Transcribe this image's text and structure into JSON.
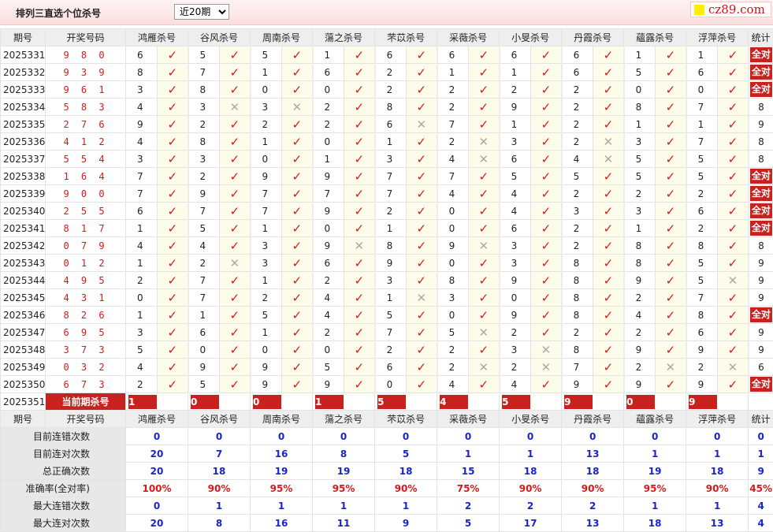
{
  "header": {
    "title": "排列三直选个位杀号",
    "period_selected": "近20期",
    "site": "cz89.com"
  },
  "columns": {
    "issue": "期号",
    "code": "开奖号码",
    "experts": [
      "鸿雁杀号",
      "谷风杀号",
      "周南杀号",
      "蕩之杀号",
      "芣苡杀号",
      "采薇杀号",
      "小旻杀号",
      "丹霞杀号",
      "蘊露杀号",
      "浮萍杀号"
    ],
    "stat": "统计"
  },
  "rows": [
    {
      "issue": "2025331",
      "code": "9 8 0",
      "kills": [
        6,
        5,
        5,
        1,
        6,
        6,
        6,
        6,
        1,
        1
      ],
      "marks": [
        1,
        1,
        1,
        1,
        1,
        1,
        1,
        1,
        1,
        1
      ],
      "stat": "全对"
    },
    {
      "issue": "2025332",
      "code": "9 3 9",
      "kills": [
        8,
        7,
        1,
        6,
        2,
        1,
        1,
        6,
        5,
        6
      ],
      "marks": [
        1,
        1,
        1,
        1,
        1,
        1,
        1,
        1,
        1,
        1
      ],
      "stat": "全对"
    },
    {
      "issue": "2025333",
      "code": "9 6 1",
      "kills": [
        3,
        8,
        0,
        0,
        2,
        2,
        2,
        2,
        0,
        0
      ],
      "marks": [
        1,
        1,
        1,
        1,
        1,
        1,
        1,
        1,
        1,
        1
      ],
      "stat": "全对"
    },
    {
      "issue": "2025334",
      "code": "5 8 3",
      "kills": [
        4,
        3,
        3,
        2,
        8,
        2,
        9,
        2,
        8,
        7
      ],
      "marks": [
        1,
        0,
        0,
        1,
        1,
        1,
        1,
        1,
        1,
        1
      ],
      "stat": "8"
    },
    {
      "issue": "2025335",
      "code": "2 7 6",
      "kills": [
        9,
        2,
        2,
        2,
        6,
        7,
        1,
        2,
        1,
        1
      ],
      "marks": [
        1,
        1,
        1,
        1,
        0,
        1,
        1,
        1,
        1,
        1
      ],
      "stat": "9"
    },
    {
      "issue": "2025336",
      "code": "4 1 2",
      "kills": [
        4,
        8,
        1,
        0,
        1,
        2,
        3,
        2,
        3,
        7
      ],
      "marks": [
        1,
        1,
        1,
        1,
        1,
        0,
        1,
        0,
        1,
        1
      ],
      "stat": "8"
    },
    {
      "issue": "2025337",
      "code": "5 5 4",
      "kills": [
        3,
        3,
        0,
        1,
        3,
        4,
        6,
        4,
        5,
        5
      ],
      "marks": [
        1,
        1,
        1,
        1,
        1,
        0,
        1,
        0,
        1,
        1
      ],
      "stat": "8"
    },
    {
      "issue": "2025338",
      "code": "1 6 4",
      "kills": [
        7,
        2,
        9,
        9,
        7,
        7,
        5,
        5,
        5,
        5
      ],
      "marks": [
        1,
        1,
        1,
        1,
        1,
        1,
        1,
        1,
        1,
        1
      ],
      "stat": "全对"
    },
    {
      "issue": "2025339",
      "code": "9 0 0",
      "kills": [
        7,
        9,
        7,
        7,
        7,
        4,
        4,
        2,
        2,
        2
      ],
      "marks": [
        1,
        1,
        1,
        1,
        1,
        1,
        1,
        1,
        1,
        1
      ],
      "stat": "全对"
    },
    {
      "issue": "2025340",
      "code": "2 5 5",
      "kills": [
        6,
        7,
        7,
        9,
        2,
        0,
        4,
        3,
        3,
        6
      ],
      "marks": [
        1,
        1,
        1,
        1,
        1,
        1,
        1,
        1,
        1,
        1
      ],
      "stat": "全对"
    },
    {
      "issue": "2025341",
      "code": "8 1 7",
      "kills": [
        1,
        5,
        1,
        0,
        1,
        0,
        6,
        2,
        1,
        2
      ],
      "marks": [
        1,
        1,
        1,
        1,
        1,
        1,
        1,
        1,
        1,
        1
      ],
      "stat": "全对"
    },
    {
      "issue": "2025342",
      "code": "0 7 9",
      "kills": [
        4,
        4,
        3,
        9,
        8,
        9,
        3,
        2,
        8,
        8
      ],
      "marks": [
        1,
        1,
        1,
        0,
        1,
        0,
        1,
        1,
        1,
        1
      ],
      "stat": "8"
    },
    {
      "issue": "2025343",
      "code": "0 1 2",
      "kills": [
        1,
        2,
        3,
        6,
        9,
        0,
        3,
        8,
        8,
        5
      ],
      "marks": [
        1,
        0,
        1,
        1,
        1,
        1,
        1,
        1,
        1,
        1
      ],
      "stat": "9"
    },
    {
      "issue": "2025344",
      "code": "4 9 5",
      "kills": [
        2,
        7,
        1,
        2,
        3,
        8,
        9,
        8,
        9,
        5
      ],
      "marks": [
        1,
        1,
        1,
        1,
        1,
        1,
        1,
        1,
        1,
        0
      ],
      "stat": "9"
    },
    {
      "issue": "2025345",
      "code": "4 3 1",
      "kills": [
        0,
        7,
        2,
        4,
        1,
        3,
        0,
        8,
        2,
        7
      ],
      "marks": [
        1,
        1,
        1,
        1,
        0,
        1,
        1,
        1,
        1,
        1
      ],
      "stat": "9"
    },
    {
      "issue": "2025346",
      "code": "8 2 6",
      "kills": [
        1,
        1,
        5,
        4,
        5,
        0,
        9,
        8,
        4,
        8
      ],
      "marks": [
        1,
        1,
        1,
        1,
        1,
        1,
        1,
        1,
        1,
        1
      ],
      "stat": "全对"
    },
    {
      "issue": "2025347",
      "code": "6 9 5",
      "kills": [
        3,
        6,
        1,
        2,
        7,
        5,
        2,
        2,
        2,
        6
      ],
      "marks": [
        1,
        1,
        1,
        1,
        1,
        0,
        1,
        1,
        1,
        1
      ],
      "stat": "9"
    },
    {
      "issue": "2025348",
      "code": "3 7 3",
      "kills": [
        5,
        0,
        0,
        0,
        2,
        2,
        3,
        8,
        9,
        9
      ],
      "marks": [
        1,
        1,
        1,
        1,
        1,
        1,
        0,
        1,
        1,
        1
      ],
      "stat": "9"
    },
    {
      "issue": "2025349",
      "code": "0 3 2",
      "kills": [
        4,
        9,
        9,
        5,
        6,
        2,
        2,
        7,
        2,
        2
      ],
      "marks": [
        1,
        1,
        1,
        1,
        1,
        0,
        0,
        1,
        0,
        0
      ],
      "stat": "6"
    },
    {
      "issue": "2025350",
      "code": "6 7 3",
      "kills": [
        2,
        5,
        9,
        9,
        0,
        4,
        4,
        9,
        9,
        9
      ],
      "marks": [
        1,
        1,
        1,
        1,
        1,
        1,
        1,
        1,
        1,
        1
      ],
      "stat": "全对"
    }
  ],
  "current": {
    "issue": "2025351",
    "label": "当前期杀号",
    "kills": [
      1,
      0,
      0,
      1,
      5,
      4,
      5,
      9,
      0,
      9
    ]
  },
  "stats": [
    {
      "label": "目前连错次数",
      "values": [
        "0",
        "0",
        "0",
        "0",
        "0",
        "0",
        "0",
        "0",
        "0",
        "0",
        "0"
      ]
    },
    {
      "label": "目前连对次数",
      "values": [
        "20",
        "7",
        "16",
        "8",
        "5",
        "1",
        "1",
        "13",
        "1",
        "1",
        "1"
      ]
    },
    {
      "label": "总正确次数",
      "values": [
        "20",
        "18",
        "19",
        "19",
        "18",
        "15",
        "18",
        "18",
        "19",
        "18",
        "9"
      ]
    },
    {
      "label": "准确率(全对率)",
      "values": [
        "100%",
        "90%",
        "95%",
        "95%",
        "90%",
        "75%",
        "90%",
        "90%",
        "95%",
        "90%",
        "45%"
      ]
    },
    {
      "label": "最大连错次数",
      "values": [
        "0",
        "1",
        "1",
        "1",
        "1",
        "2",
        "2",
        "2",
        "1",
        "1",
        "4"
      ]
    },
    {
      "label": "最大连对次数",
      "values": [
        "20",
        "8",
        "16",
        "11",
        "9",
        "5",
        "17",
        "13",
        "18",
        "13",
        "4"
      ]
    }
  ],
  "colors": {
    "accent": "#c8221e",
    "blue": "#1a24c7",
    "red": "#d61a1a"
  },
  "icons": {
    "correct": "check-icon",
    "wrong": "cross-icon"
  }
}
